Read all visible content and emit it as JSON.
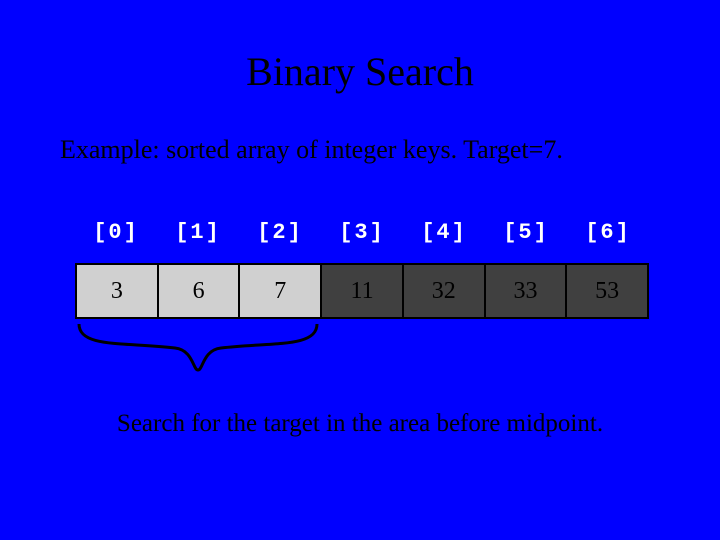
{
  "title": "Binary Search",
  "subtitle": "Example: sorted array of integer keys.  Target=7.",
  "indices": {
    "i0": "[0]",
    "i1": "[1]",
    "i2": "[2]",
    "i3": "[3]",
    "i4": "[4]",
    "i5": "[5]",
    "i6": "[6]"
  },
  "values": {
    "v0": "3",
    "v1": "6",
    "v2": "7",
    "v3": "11",
    "v4": "32",
    "v5": "33",
    "v6": "53"
  },
  "caption": "Search for the target in the area before midpoint."
}
